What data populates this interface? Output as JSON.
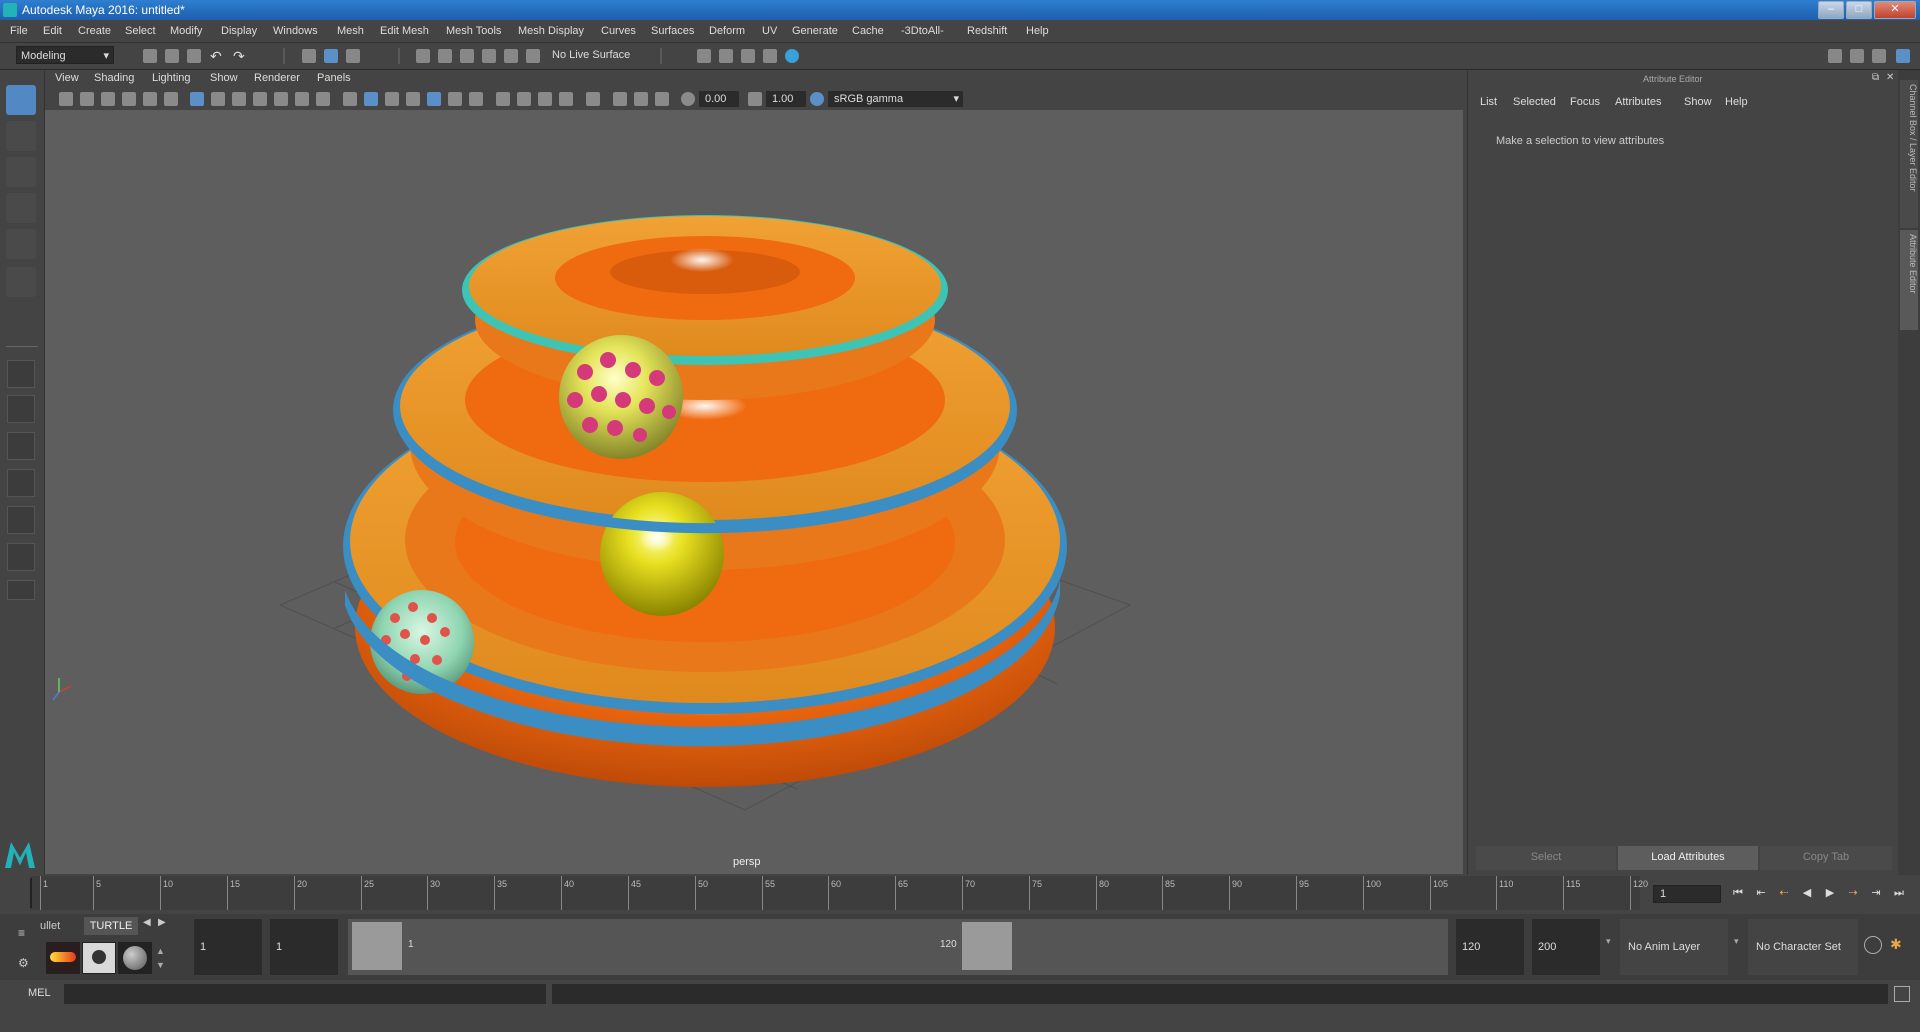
{
  "window": {
    "title": "Autodesk Maya 2016: untitled*",
    "min": "–",
    "max": "□",
    "close": "✕"
  },
  "menubar": [
    "File",
    "Edit",
    "Create",
    "Select",
    "Modify",
    "Display",
    "Windows",
    "Mesh",
    "Edit Mesh",
    "Mesh Tools",
    "Mesh Display",
    "Curves",
    "Surfaces",
    "Deform",
    "UV",
    "Generate",
    "Cache",
    "-3DtoAll-",
    "Redshift",
    "Help"
  ],
  "statusline": {
    "mode": "Modeling",
    "live_surface": "No Live Surface"
  },
  "panel": {
    "menus": [
      "View",
      "Shading",
      "Lighting",
      "Show",
      "Renderer",
      "Panels"
    ],
    "exposure": "0.00",
    "gamma": "1.00",
    "color_space": "sRGB gamma",
    "camera_label": "persp"
  },
  "attribute_editor": {
    "title": "Attribute Editor",
    "menus": [
      "List",
      "Selected",
      "Focus",
      "Attributes",
      "Show",
      "Help"
    ],
    "message": "Make a selection to view attributes",
    "buttons": {
      "select": "Select",
      "load": "Load Attributes",
      "copy_tab": "Copy Tab"
    }
  },
  "side_tabs": [
    "Channel Box / Layer Editor",
    "Attribute Editor"
  ],
  "timeline": {
    "ticks": [
      "1",
      "5",
      "10",
      "15",
      "20",
      "25",
      "30",
      "35",
      "40",
      "45",
      "50",
      "55",
      "60",
      "65",
      "70",
      "75",
      "80",
      "85",
      "90",
      "95",
      "100",
      "105",
      "110",
      "115",
      "120"
    ],
    "current_frame": "1"
  },
  "range": {
    "shelf_tabs": [
      "ullet",
      "TURTLE"
    ],
    "start": "1",
    "playback_start": "1",
    "slider_start": "1",
    "slider_end": "120",
    "playback_end": "120",
    "end": "200",
    "anim_layer": "No Anim Layer",
    "character_set": "No Character Set"
  },
  "cmdline": {
    "label": "MEL"
  }
}
